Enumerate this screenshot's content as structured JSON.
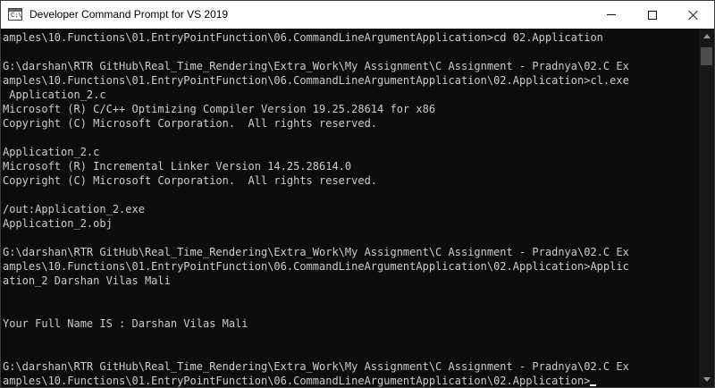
{
  "window": {
    "title": "Developer Command Prompt for VS 2019",
    "icon_glyph": "C:\\",
    "icon": "cmd-app-icon"
  },
  "title_buttons": {
    "minimize_icon": "minimize-icon",
    "maximize_icon": "maximize-icon",
    "close_icon": "close-icon"
  },
  "console": {
    "lines": [
      "amples\\10.Functions\\01.EntryPointFunction\\06.CommandLineArgumentApplication>cd 02.Application",
      "",
      "G:\\darshan\\RTR GitHub\\Real_Time_Rendering\\Extra_Work\\My Assignment\\C Assignment - Pradnya\\02.C Ex",
      "amples\\10.Functions\\01.EntryPointFunction\\06.CommandLineArgumentApplication\\02.Application>cl.exe",
      " Application_2.c",
      "Microsoft (R) C/C++ Optimizing Compiler Version 19.25.28614 for x86",
      "Copyright (C) Microsoft Corporation.  All rights reserved.",
      "",
      "Application_2.c",
      "Microsoft (R) Incremental Linker Version 14.25.28614.0",
      "Copyright (C) Microsoft Corporation.  All rights reserved.",
      "",
      "/out:Application_2.exe",
      "Application_2.obj",
      "",
      "G:\\darshan\\RTR GitHub\\Real_Time_Rendering\\Extra_Work\\My Assignment\\C Assignment - Pradnya\\02.C Ex",
      "amples\\10.Functions\\01.EntryPointFunction\\06.CommandLineArgumentApplication\\02.Application>Applic",
      "ation_2 Darshan Vilas Mali",
      "",
      "",
      "Your Full Name IS : Darshan Vilas Mali",
      "",
      "",
      "G:\\darshan\\RTR GitHub\\Real_Time_Rendering\\Extra_Work\\My Assignment\\C Assignment - Pradnya\\02.C Ex",
      "amples\\10.Functions\\01.EntryPointFunction\\06.CommandLineArgumentApplication\\02.Application>"
    ]
  },
  "colors": {
    "background": "#0c0c0c",
    "text": "#cccccc",
    "titlebar": "#ffffff"
  }
}
